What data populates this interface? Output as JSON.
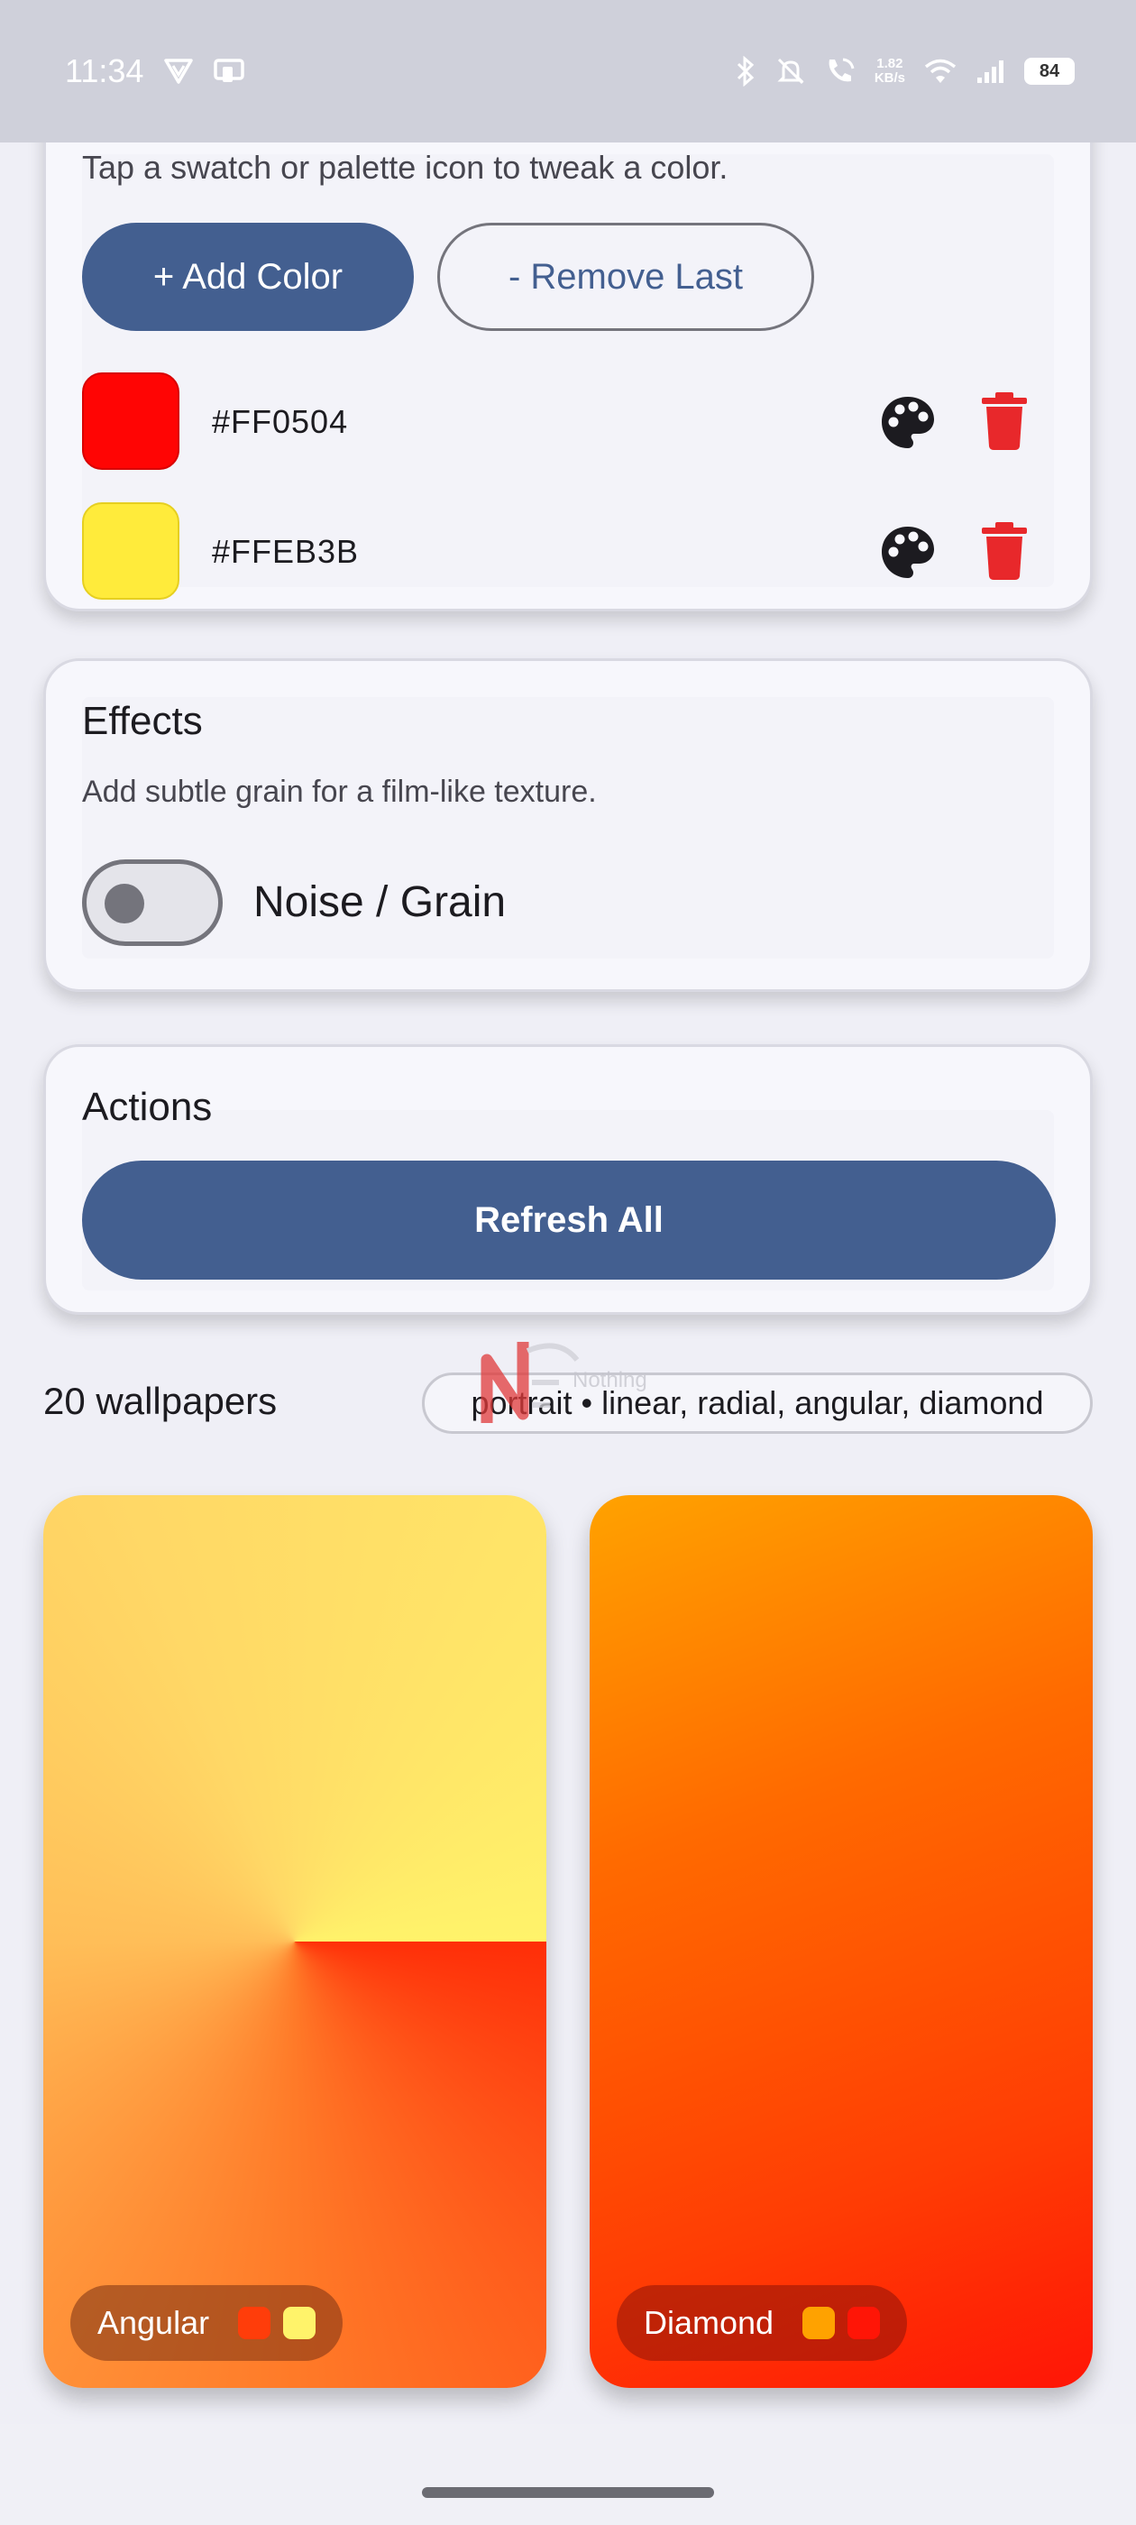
{
  "status_bar": {
    "time": "11:34",
    "net_speed_value": "1.82",
    "net_speed_unit": "KB/s",
    "battery": "84",
    "icons": [
      "vpn-icon",
      "screen-cast-icon",
      "bluetooth-icon",
      "mute-icon",
      "wifi-calling-icon",
      "wifi-icon",
      "signal-icon",
      "battery-icon"
    ]
  },
  "colors_card": {
    "hint": "Tap a swatch or palette icon to tweak a color.",
    "add_label": "+ Add Color",
    "remove_label": "- Remove Last",
    "colors": [
      {
        "hex": "#FF0504",
        "color": "#FF0504"
      },
      {
        "hex": "#FFEB3B",
        "color": "#FFEB3B"
      }
    ]
  },
  "effects_card": {
    "title": "Effects",
    "description": "Add subtle grain for a film-like texture.",
    "toggle_label": "Noise / Grain",
    "toggle_on": false
  },
  "actions_card": {
    "title": "Actions",
    "refresh_label": "Refresh All"
  },
  "gallery": {
    "count_label": "20 wallpapers",
    "filter_chip": "portrait • linear, radial, angular, diamond",
    "watermark_text": "Nothing",
    "wallpapers": [
      {
        "label": "Angular",
        "swatches": [
          "#FF3D0A",
          "#FFF36A"
        ]
      },
      {
        "label": "Diamond",
        "swatches": [
          "#FFA200",
          "#FF1506"
        ]
      }
    ]
  },
  "theme": {
    "primary": "#435F90",
    "delete": "#E8282B"
  }
}
